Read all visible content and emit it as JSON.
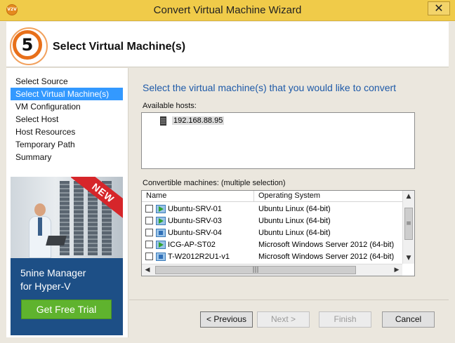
{
  "window": {
    "app_icon_text": "V2V",
    "title": "Convert Virtual Machine Wizard",
    "close_glyph": "✕"
  },
  "header": {
    "step_number": "5",
    "title": "Select Virtual Machine(s)"
  },
  "sidebar": {
    "items": [
      {
        "label": "Select Source",
        "active": false
      },
      {
        "label": "Select Virtual Machine(s)",
        "active": true
      },
      {
        "label": "VM Configuration",
        "active": false
      },
      {
        "label": "Select Host",
        "active": false
      },
      {
        "label": "Host Resources",
        "active": false
      },
      {
        "label": "Temporary Path",
        "active": false
      },
      {
        "label": "Summary",
        "active": false
      }
    ]
  },
  "ad": {
    "badge": "NEW",
    "line1": "5nine Manager",
    "line2": "for Hyper-V",
    "button": "Get Free Trial"
  },
  "main": {
    "prompt": "Select the virtual machine(s) that you would like to convert",
    "hosts_label": "Available hosts:",
    "hosts": [
      "192.168.88.95"
    ],
    "machines_label": "Convertible machines: (multiple selection)",
    "columns": {
      "name": "Name",
      "os": "Operating System"
    },
    "machines": [
      {
        "name": "Ubuntu-SRV-01",
        "os": "Ubuntu Linux (64-bit)",
        "icon": "vm-running-icon"
      },
      {
        "name": "Ubuntu-SRV-03",
        "os": "Ubuntu Linux (64-bit)",
        "icon": "vm-running-icon"
      },
      {
        "name": "Ubuntu-SRV-04",
        "os": "Ubuntu Linux (64-bit)",
        "icon": "vm-icon"
      },
      {
        "name": "ICG-AP-ST02",
        "os": "Microsoft Windows Server 2012 (64-bit)",
        "icon": "vm-running-icon"
      },
      {
        "name": "T-W2012R2U1-v1",
        "os": "Microsoft Windows Server 2012 (64-bit)",
        "icon": "vm-icon"
      }
    ]
  },
  "footer": {
    "previous": "< Previous",
    "next": "Next >",
    "finish": "Finish",
    "cancel": "Cancel"
  }
}
